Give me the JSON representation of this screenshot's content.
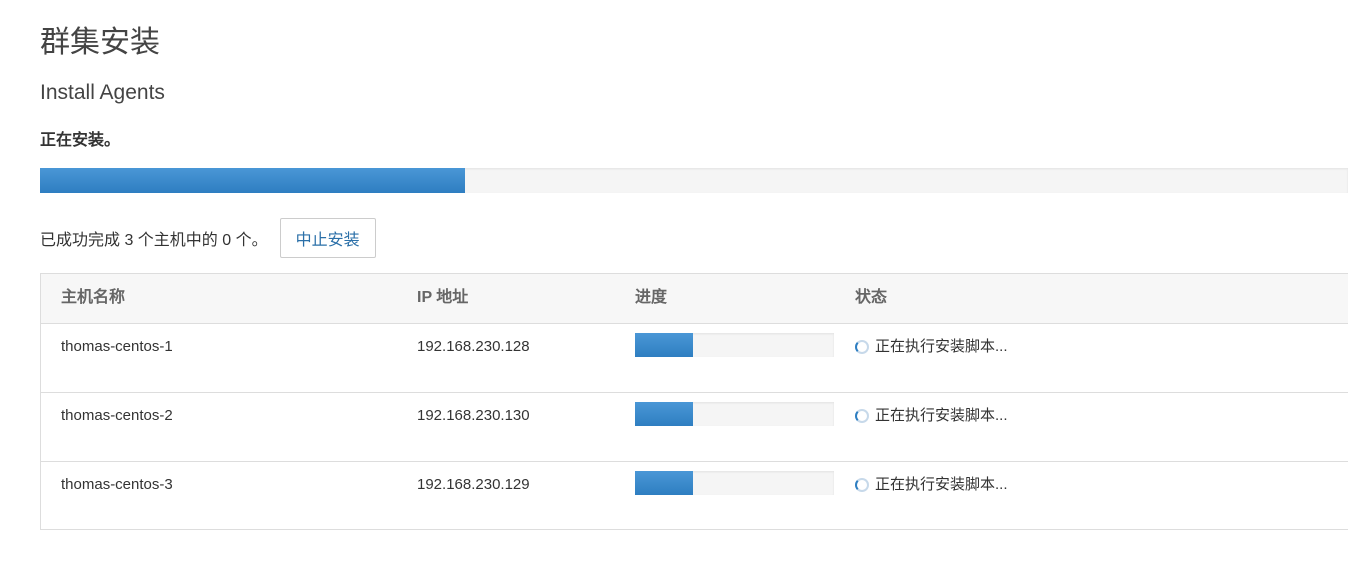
{
  "page": {
    "title": "群集安装",
    "subtitle": "Install Agents",
    "status": "正在安装。"
  },
  "overall_progress": 0.325,
  "summary": {
    "text": "已成功完成 3 个主机中的 0 个。",
    "abort_button_label": "中止安装"
  },
  "table": {
    "headers": {
      "host": "主机名称",
      "ip": "IP 地址",
      "progress": "进度",
      "status": "状态"
    },
    "rows": [
      {
        "host": "thomas-centos-1",
        "ip": "192.168.230.128",
        "progress": 0.29,
        "status": "正在执行安装脚本..."
      },
      {
        "host": "thomas-centos-2",
        "ip": "192.168.230.130",
        "progress": 0.29,
        "status": "正在执行安装脚本..."
      },
      {
        "host": "thomas-centos-3",
        "ip": "192.168.230.129",
        "progress": 0.29,
        "status": "正在执行安装脚本..."
      }
    ]
  },
  "colors": {
    "progress_fill": "#2e7ec1",
    "progress_track": "#f5f5f5",
    "link_text": "#2a6fa8"
  }
}
